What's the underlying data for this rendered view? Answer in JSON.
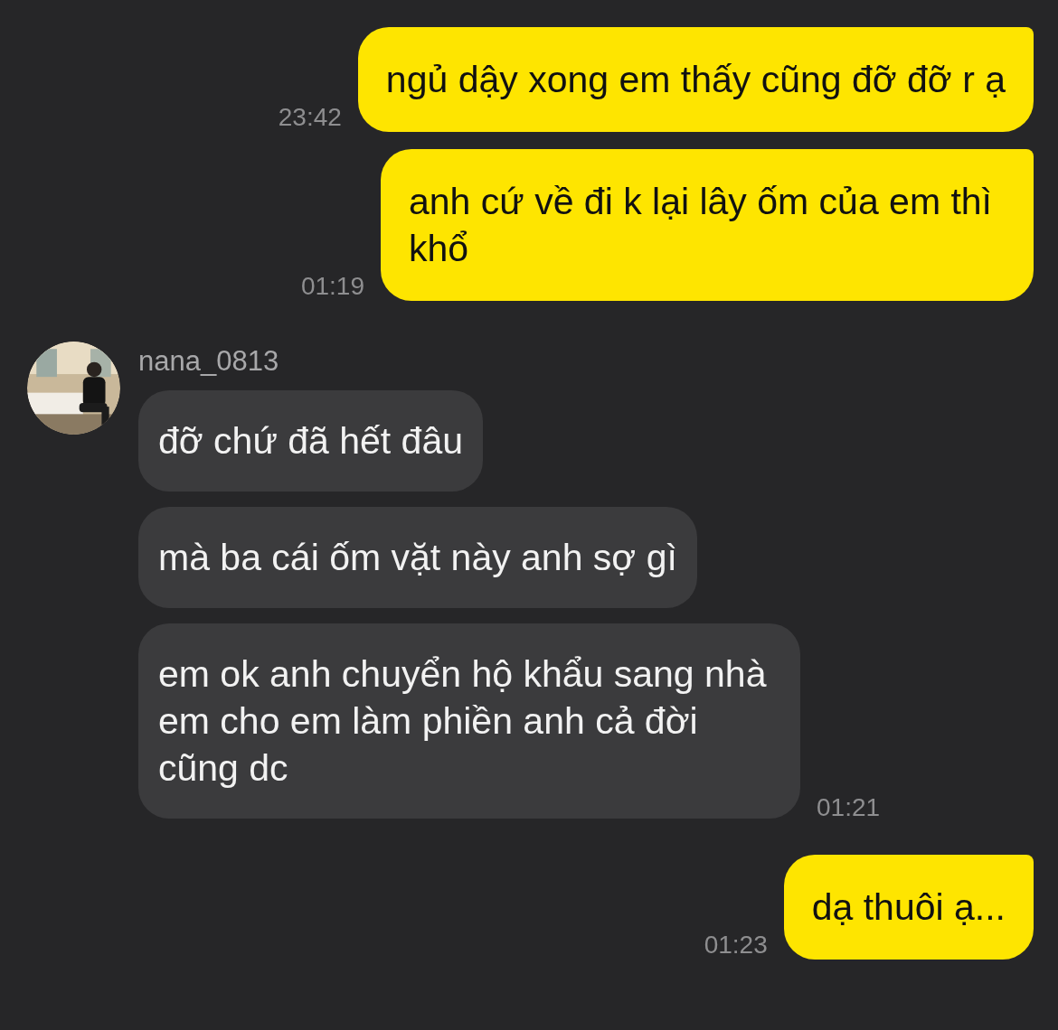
{
  "messages": [
    {
      "kind": "outgoing",
      "text": "ngủ dậy xong em thấy cũng đỡ đỡ r ạ",
      "time": "23:42"
    },
    {
      "kind": "outgoing",
      "text": "anh cứ về đi k lại lây ốm của em thì khổ",
      "time": "01:19"
    },
    {
      "kind": "incoming",
      "sender": "nana_0813",
      "avatar": {
        "kind": "picture"
      },
      "bubbles": [
        {
          "text": "đỡ chứ đã hết đâu"
        },
        {
          "text": "mà ba cái ốm vặt này anh sợ gì"
        },
        {
          "text": "em ok anh chuyển hộ khẩu sang nhà em cho em làm phiền anh cả đời cũng dc",
          "time": "01:21"
        }
      ]
    },
    {
      "kind": "outgoing",
      "text": "dạ thuôi ạ...",
      "time": "01:23"
    }
  ]
}
